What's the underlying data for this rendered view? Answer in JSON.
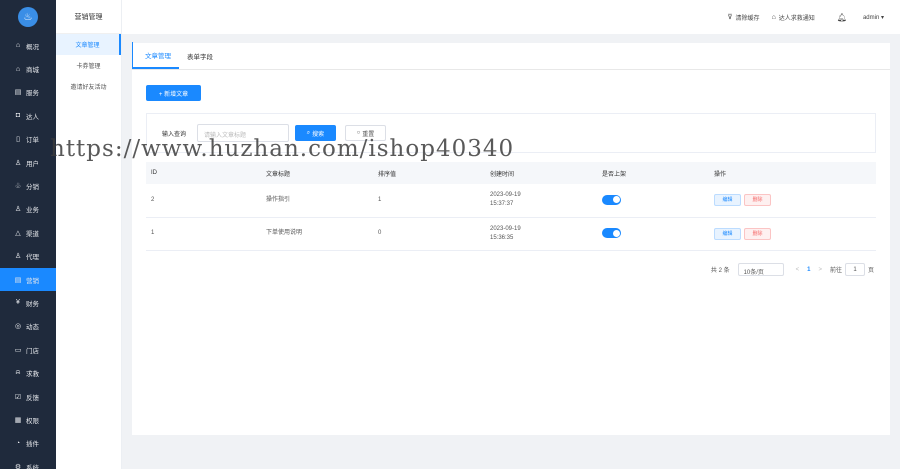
{
  "sidebar": {
    "logo": "logo",
    "items": [
      {
        "label": "概况",
        "icon": "home-icon",
        "glyph": "⌂"
      },
      {
        "label": "商城",
        "icon": "shop-icon",
        "glyph": "⌂"
      },
      {
        "label": "服务",
        "icon": "service-icon",
        "glyph": "▤"
      },
      {
        "label": "达人",
        "icon": "talent-icon",
        "glyph": "◘"
      },
      {
        "label": "订单",
        "icon": "order-icon",
        "glyph": "▯"
      },
      {
        "label": "用户",
        "icon": "users-icon",
        "glyph": "♙"
      },
      {
        "label": "分销",
        "icon": "distribution-icon",
        "glyph": "♧"
      },
      {
        "label": "业务",
        "icon": "business-icon",
        "glyph": "♙"
      },
      {
        "label": "渠道",
        "icon": "channel-icon",
        "glyph": "△"
      },
      {
        "label": "代理",
        "icon": "agent-icon",
        "glyph": "♙"
      },
      {
        "label": "营销",
        "icon": "marketing-icon",
        "glyph": "▤",
        "active": true
      },
      {
        "label": "财务",
        "icon": "finance-icon",
        "glyph": "¥"
      },
      {
        "label": "动态",
        "icon": "feed-icon",
        "glyph": "◎"
      },
      {
        "label": "门店",
        "icon": "store-icon",
        "glyph": "▭"
      },
      {
        "label": "求救",
        "icon": "sos-icon",
        "glyph": "⍾"
      },
      {
        "label": "反馈",
        "icon": "feedback-icon",
        "glyph": "☑"
      },
      {
        "label": "权限",
        "icon": "permission-icon",
        "glyph": "▦"
      },
      {
        "label": "插件",
        "icon": "plugin-icon",
        "glyph": "◔"
      },
      {
        "label": "系统",
        "icon": "system-icon",
        "glyph": "⚙"
      }
    ]
  },
  "subnav": {
    "title": "营销管理",
    "items": [
      "文章管理",
      "卡券管理",
      "邀请好友活动"
    ]
  },
  "topbar": {
    "clear_cache": "清除缓存",
    "notify": "达人求救通知",
    "user": "admin ▾"
  },
  "tabs": [
    "文章管理",
    "表单字段"
  ],
  "actions": {
    "new_article": "+ 新增文章"
  },
  "filter": {
    "label": "输入查询",
    "placeholder": "请输入文章标题",
    "search": "搜索",
    "reset": "重置"
  },
  "table": {
    "headers": [
      "ID",
      "文章标题",
      "排序值",
      "创建时间",
      "是否上架",
      "操作"
    ],
    "rows": [
      {
        "id": "2",
        "title": "操作指引",
        "sort": "1",
        "date": "2023-09-19",
        "time": "15:37:37",
        "on": true
      },
      {
        "id": "1",
        "title": "下单使用说明",
        "sort": "0",
        "date": "2023-09-19",
        "time": "15:36:35",
        "on": true
      }
    ],
    "edit": "编辑",
    "delete": "删除"
  },
  "pagination": {
    "total": "共 2 条",
    "page_size": "10条/页",
    "prev": "<",
    "current": "1",
    "next": ">",
    "goto": "前往",
    "goto_value": "1",
    "page_unit": "页"
  },
  "watermark": "https://www.huzhan.com/ishop40340",
  "colors": {
    "primary": "#1a89ff",
    "sidebar": "#1f2a3c",
    "danger": "#f56c6c"
  }
}
